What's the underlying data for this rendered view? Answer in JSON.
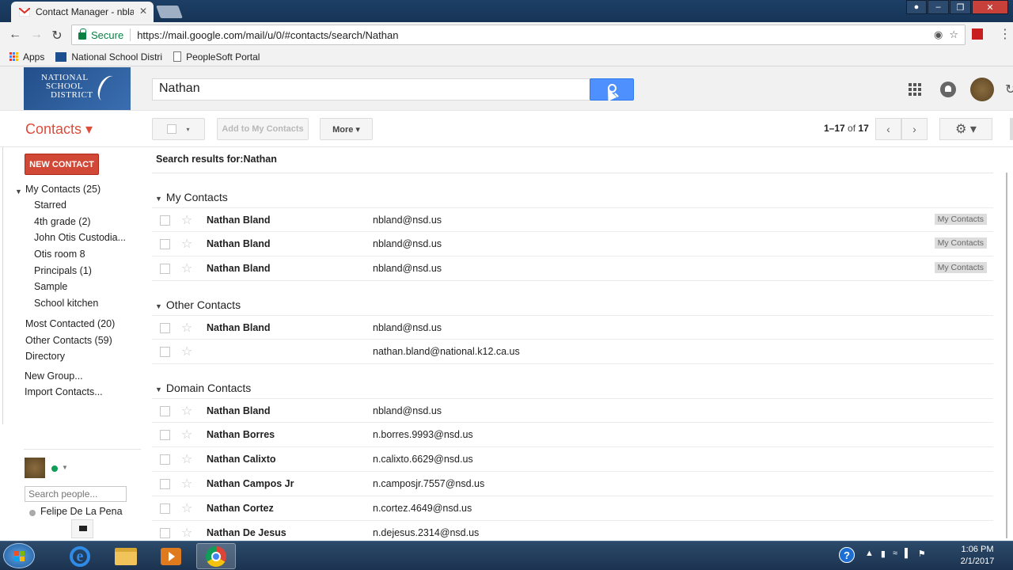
{
  "browser": {
    "tab_title": "Contact Manager - nbla",
    "tab_close": "✕",
    "secure_label": "Secure",
    "url": "https://mail.google.com/mail/u/0/#contacts/search/Nathan",
    "bookmarks": [
      {
        "label": "Apps",
        "icon": "apps-grid-icon"
      },
      {
        "label": "National School Distri",
        "icon": "nsd-icon"
      },
      {
        "label": "PeopleSoft Portal",
        "icon": "page-icon"
      }
    ]
  },
  "header": {
    "logo_line1": "NATIONAL",
    "logo_line2": "SCHOOL",
    "logo_line3": "DISTRICT",
    "search_value": "Nathan"
  },
  "toolbar": {
    "contacts_title": "Contacts ▾",
    "select_caret": "▾",
    "add_to_my_contacts": "Add to My Contacts",
    "more": "More ▾",
    "pager_range": "1–17",
    "pager_of": "of",
    "pager_total": "17",
    "prev": "‹",
    "next": "›",
    "settings": "⚙ ▾"
  },
  "sidebar": {
    "new_contact": "NEW CONTACT",
    "my_contacts": "My Contacts (25)",
    "sub_items": [
      "Starred",
      "4th grade (2)",
      "John Otis Custodia...",
      "Otis room 8",
      "Principals (1)",
      "Sample",
      "School kitchen"
    ],
    "most_contacted": "Most Contacted (20)",
    "other_contacts": "Other Contacts (59)",
    "directory": "Directory",
    "new_group": "New Group...",
    "import_contacts": "Import Contacts...",
    "search_people_placeholder": "Search people...",
    "chat_person": "Felipe De La Pena"
  },
  "main": {
    "results_prefix": "Search results for:",
    "results_query": "Nathan",
    "groups": [
      {
        "title": "My Contacts",
        "rows": [
          {
            "name": "Nathan Bland",
            "email": "nbland@nsd.us",
            "label": "My Contacts"
          },
          {
            "name": "Nathan Bland",
            "email": "nbland@nsd.us",
            "label": "My Contacts"
          },
          {
            "name": "Nathan Bland",
            "email": "nbland@nsd.us",
            "label": "My Contacts"
          }
        ]
      },
      {
        "title": "Other Contacts",
        "rows": [
          {
            "name": "Nathan Bland",
            "email": "nbland@nsd.us",
            "label": ""
          },
          {
            "name": "",
            "email": "nathan.bland@national.k12.ca.us",
            "label": ""
          }
        ]
      },
      {
        "title": "Domain Contacts",
        "rows": [
          {
            "name": "Nathan Bland",
            "email": "nbland@nsd.us",
            "label": ""
          },
          {
            "name": "Nathan Borres",
            "email": "n.borres.9993@nsd.us",
            "label": ""
          },
          {
            "name": "Nathan Calixto",
            "email": "n.calixto.6629@nsd.us",
            "label": ""
          },
          {
            "name": "Nathan Campos Jr",
            "email": "n.camposjr.7557@nsd.us",
            "label": ""
          },
          {
            "name": "Nathan Cortez",
            "email": "n.cortez.4649@nsd.us",
            "label": ""
          },
          {
            "name": "Nathan De Jesus",
            "email": "n.dejesus.2314@nsd.us",
            "label": ""
          }
        ]
      }
    ]
  },
  "taskbar": {
    "help": "?",
    "time": "1:06 PM",
    "date": "2/1/2017"
  },
  "colors": {
    "accent_red": "#dd4b39",
    "new_contact_red": "#d14836",
    "search_blue": "#4d90fe",
    "secure_green": "#0b8043"
  }
}
